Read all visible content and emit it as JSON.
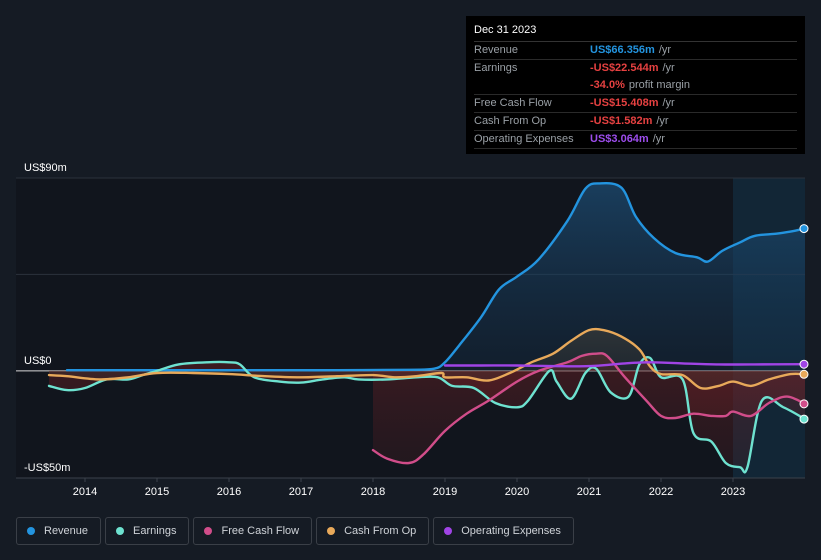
{
  "tooltip": {
    "date": "Dec 31 2023",
    "rows": [
      {
        "label": "Revenue",
        "value": "US$66.356m",
        "unit": "/yr",
        "color": "#2394df"
      },
      {
        "label": "Earnings",
        "value": "-US$22.544m",
        "unit": "/yr",
        "color": "#e64141"
      },
      {
        "label": "",
        "value": "-34.0%",
        "unit": "profit margin",
        "color": "#e64141"
      },
      {
        "label": "Free Cash Flow",
        "value": "-US$15.408m",
        "unit": "/yr",
        "color": "#e64141"
      },
      {
        "label": "Cash From Op",
        "value": "-US$1.582m",
        "unit": "/yr",
        "color": "#e64141"
      },
      {
        "label": "Operating Expenses",
        "value": "US$3.064m",
        "unit": "/yr",
        "color": "#9d4ded"
      }
    ]
  },
  "legend": [
    {
      "label": "Revenue",
      "color": "#2394df"
    },
    {
      "label": "Earnings",
      "color": "#6ee2d0"
    },
    {
      "label": "Free Cash Flow",
      "color": "#d14d8a"
    },
    {
      "label": "Cash From Op",
      "color": "#e8a95a"
    },
    {
      "label": "Operating Expenses",
      "color": "#a044e6"
    }
  ],
  "chart_data": {
    "type": "line",
    "title": "",
    "xlabel": "",
    "ylabel": "",
    "ylim": [
      -50,
      90
    ],
    "xlim": [
      2013.5,
      2024.0
    ],
    "y_tick_labels": [
      {
        "value": 90,
        "label": "US$90m"
      },
      {
        "value": 0,
        "label": "US$0"
      },
      {
        "value": -50,
        "label": "-US$50m"
      }
    ],
    "x_tick_labels": [
      "2014",
      "2015",
      "2016",
      "2017",
      "2018",
      "2019",
      "2020",
      "2021",
      "2022",
      "2023"
    ],
    "x_ticks": [
      2014,
      2015,
      2016,
      2017,
      2018,
      2019,
      2020,
      2021,
      2022,
      2023
    ],
    "forecast_region_start": 2023.0,
    "grid": true,
    "legend_position": "bottom-left",
    "series": [
      {
        "name": "Revenue",
        "color": "#2394df",
        "points": [
          [
            2013.75,
            0.3
          ],
          [
            2014.5,
            0.3
          ],
          [
            2015.5,
            0.3
          ],
          [
            2016.5,
            0.3
          ],
          [
            2017.5,
            0.3
          ],
          [
            2018.5,
            0.5
          ],
          [
            2018.85,
            1
          ],
          [
            2019.0,
            4
          ],
          [
            2019.2,
            12
          ],
          [
            2019.5,
            25
          ],
          [
            2019.75,
            38
          ],
          [
            2020.0,
            44
          ],
          [
            2020.3,
            52
          ],
          [
            2020.7,
            70
          ],
          [
            2020.95,
            85
          ],
          [
            2021.15,
            87.5
          ],
          [
            2021.45,
            85.5
          ],
          [
            2021.65,
            72
          ],
          [
            2021.9,
            62
          ],
          [
            2022.2,
            55
          ],
          [
            2022.5,
            53
          ],
          [
            2022.65,
            51
          ],
          [
            2022.85,
            56
          ],
          [
            2023.1,
            60
          ],
          [
            2023.3,
            63
          ],
          [
            2023.6,
            64
          ],
          [
            2023.8,
            65
          ],
          [
            2024.0,
            66.4
          ]
        ]
      },
      {
        "name": "Earnings",
        "color": "#6ee2d0",
        "points": [
          [
            2013.5,
            -7
          ],
          [
            2013.75,
            -9
          ],
          [
            2014.0,
            -8
          ],
          [
            2014.3,
            -4
          ],
          [
            2014.6,
            -4
          ],
          [
            2014.8,
            -2
          ],
          [
            2015.0,
            0
          ],
          [
            2015.3,
            3
          ],
          [
            2015.7,
            4
          ],
          [
            2016.0,
            4
          ],
          [
            2016.15,
            3
          ],
          [
            2016.35,
            -3
          ],
          [
            2016.7,
            -5
          ],
          [
            2017.0,
            -5.5
          ],
          [
            2017.3,
            -4
          ],
          [
            2017.6,
            -3
          ],
          [
            2017.8,
            -4
          ],
          [
            2018.2,
            -4
          ],
          [
            2018.6,
            -3
          ],
          [
            2018.9,
            -3
          ],
          [
            2019.1,
            -7
          ],
          [
            2019.4,
            -8
          ],
          [
            2019.7,
            -15
          ],
          [
            2020.0,
            -17
          ],
          [
            2020.15,
            -14
          ],
          [
            2020.45,
            0
          ],
          [
            2020.55,
            -5
          ],
          [
            2020.75,
            -13
          ],
          [
            2020.95,
            -1
          ],
          [
            2021.1,
            1
          ],
          [
            2021.3,
            -10
          ],
          [
            2021.55,
            -12
          ],
          [
            2021.7,
            3
          ],
          [
            2021.85,
            6
          ],
          [
            2022.0,
            -3
          ],
          [
            2022.3,
            -4
          ],
          [
            2022.45,
            -29
          ],
          [
            2022.7,
            -33
          ],
          [
            2022.9,
            -43
          ],
          [
            2023.1,
            -45
          ],
          [
            2023.2,
            -45
          ],
          [
            2023.4,
            -14
          ],
          [
            2023.7,
            -17
          ],
          [
            2024.0,
            -22.5
          ]
        ]
      },
      {
        "name": "Free Cash Flow",
        "color": "#d14d8a",
        "points": [
          [
            2018.0,
            -37
          ],
          [
            2018.2,
            -41
          ],
          [
            2018.5,
            -43
          ],
          [
            2018.7,
            -39
          ],
          [
            2019.0,
            -28
          ],
          [
            2019.3,
            -20
          ],
          [
            2019.6,
            -14
          ],
          [
            2020.0,
            -5
          ],
          [
            2020.3,
            0
          ],
          [
            2020.7,
            4
          ],
          [
            2020.9,
            7
          ],
          [
            2021.1,
            8
          ],
          [
            2021.25,
            7
          ],
          [
            2021.5,
            -3
          ],
          [
            2021.8,
            -14
          ],
          [
            2022.0,
            -21
          ],
          [
            2022.2,
            -22
          ],
          [
            2022.45,
            -20
          ],
          [
            2022.7,
            -21
          ],
          [
            2022.9,
            -21
          ],
          [
            2023.0,
            -19
          ],
          [
            2023.25,
            -21
          ],
          [
            2023.5,
            -15
          ],
          [
            2023.75,
            -12
          ],
          [
            2024.0,
            -15.4
          ]
        ]
      },
      {
        "name": "Cash From Op",
        "color": "#e8a95a",
        "points": [
          [
            2013.5,
            -2
          ],
          [
            2013.75,
            -2.5
          ],
          [
            2014.2,
            -4
          ],
          [
            2014.6,
            -3
          ],
          [
            2015.0,
            -1
          ],
          [
            2015.5,
            -1
          ],
          [
            2016.0,
            -1.5
          ],
          [
            2016.5,
            -2.5
          ],
          [
            2017.0,
            -3
          ],
          [
            2017.5,
            -2.5
          ],
          [
            2018.0,
            -2
          ],
          [
            2018.3,
            -3
          ],
          [
            2018.6,
            -2.5
          ],
          [
            2018.95,
            -1
          ],
          [
            2019.0,
            -3
          ],
          [
            2019.3,
            -3
          ],
          [
            2019.6,
            -4.5
          ],
          [
            2019.9,
            -1
          ],
          [
            2020.2,
            4
          ],
          [
            2020.5,
            8
          ],
          [
            2020.75,
            14
          ],
          [
            2021.0,
            19
          ],
          [
            2021.2,
            19
          ],
          [
            2021.45,
            16
          ],
          [
            2021.7,
            10
          ],
          [
            2021.85,
            2
          ],
          [
            2022.0,
            -1.5
          ],
          [
            2022.3,
            -2
          ],
          [
            2022.55,
            -8
          ],
          [
            2022.8,
            -7
          ],
          [
            2023.0,
            -5
          ],
          [
            2023.25,
            -7
          ],
          [
            2023.5,
            -4
          ],
          [
            2023.8,
            -1.5
          ],
          [
            2024.0,
            -1.6
          ]
        ]
      },
      {
        "name": "Operating Expenses",
        "color": "#a044e6",
        "points": [
          [
            2019.0,
            2.5
          ],
          [
            2019.5,
            2.5
          ],
          [
            2020.0,
            2.5
          ],
          [
            2020.5,
            2.2
          ],
          [
            2021.0,
            2.2
          ],
          [
            2021.5,
            3.5
          ],
          [
            2021.85,
            4
          ],
          [
            2022.3,
            3.5
          ],
          [
            2022.8,
            3
          ],
          [
            2023.3,
            3
          ],
          [
            2024.0,
            3.1
          ]
        ]
      }
    ]
  }
}
